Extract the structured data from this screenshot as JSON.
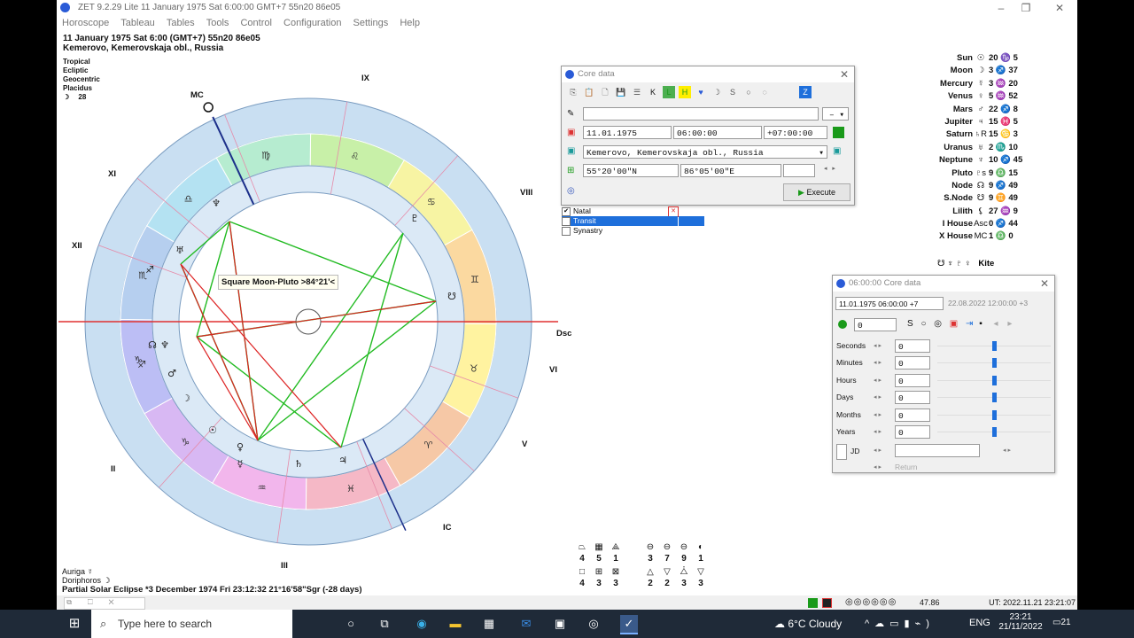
{
  "window": {
    "title": "ZET 9.2.29 Lite   11 January 1975  Sat   6:00:00 GMT+7 55n20  86e05",
    "menu": [
      "Horoscope",
      "Tableau",
      "Tables",
      "Tools",
      "Control",
      "Configuration",
      "Settings",
      "Help"
    ]
  },
  "header": {
    "line1": "11 January 1975  Sat   6:00  (GMT+7)  55n20   86e05",
    "line2": "Kemerovo, Kemerovskaja obl., Russia",
    "meta": [
      "Tropical",
      "Ecliptic",
      "Geocentric",
      "Placidus"
    ],
    "moon_day": "28"
  },
  "chart": {
    "house_labels": [
      "MC",
      "IX",
      "VIII",
      "Dsc",
      "VI",
      "V",
      "IC",
      "III",
      "II",
      "XII",
      "XI"
    ],
    "tooltip": "Square Moon-Pluto >84°21'<",
    "colors": {
      "outer_ring": "#c9dff2",
      "inner_ring": "#dbe9f6",
      "aspect_green": "#22bb22",
      "aspect_red": "#dd2222"
    }
  },
  "planets": [
    {
      "name": "Sun",
      "glyph": "☉",
      "pos": "20 ♑ 5"
    },
    {
      "name": "Moon",
      "glyph": "☽",
      "pos": "3 ♐ 37"
    },
    {
      "name": "Mercury",
      "glyph": "☿",
      "pos": "3 ♒ 20"
    },
    {
      "name": "Venus",
      "glyph": "♀",
      "pos": "5 ♒ 52"
    },
    {
      "name": "Mars",
      "glyph": "♂",
      "pos": "22 ♐ 8"
    },
    {
      "name": "Jupiter",
      "glyph": "♃",
      "pos": "15 ♓ 5"
    },
    {
      "name": "Saturn",
      "glyph": "♄R",
      "pos": "15 ♋ 3"
    },
    {
      "name": "Uranus",
      "glyph": "♅",
      "pos": "2 ♏ 10"
    },
    {
      "name": "Neptune",
      "glyph": "♆",
      "pos": "10 ♐ 45"
    },
    {
      "name": "Pluto",
      "glyph": "♇s",
      "pos": "9 ♎ 15"
    },
    {
      "name": "Node",
      "glyph": "☊",
      "pos": "9 ♐ 49"
    },
    {
      "name": "S.Node",
      "glyph": "☋",
      "pos": "9 ♊ 49"
    },
    {
      "name": "Lilith",
      "glyph": "⚸",
      "pos": "27 ♒ 9"
    },
    {
      "name": "I House",
      "glyph": "Asc",
      "pos": "0 ♐ 44"
    },
    {
      "name": "X House",
      "glyph": "MC",
      "pos": "1 ♎ 0"
    }
  ],
  "kite": {
    "glyphs": "☋ ♆ ♇ ♀",
    "label": "Kite"
  },
  "core_data": {
    "title": "Core data",
    "date": "11.01.1975",
    "time": "06:00:00",
    "zone": "+07:00:00",
    "place": "Kemerovo, Kemerovskaja obl., Russia",
    "lat": "55°20'00\"N",
    "lon": "86°05'00\"E",
    "execute_label": "Execute",
    "toolbar": [
      "⎘",
      "📋",
      "🗋",
      "💾",
      "☰",
      "K",
      "L",
      "H",
      "♥",
      "☽",
      "S",
      "○",
      "◌",
      "Z"
    ],
    "options": [
      {
        "label": "Natal",
        "checked": true
      },
      {
        "label": "Transit",
        "checked": false,
        "selected": true
      },
      {
        "label": "Synastry",
        "checked": false
      }
    ]
  },
  "timer_panel": {
    "title": "06:00:00 Core data",
    "from": "11.01.1975  06:00:00  +7",
    "to": "22.08.2022   12:00:00  +3",
    "step_value": "0",
    "rows": [
      {
        "label": "Seconds",
        "value": "0"
      },
      {
        "label": "Minutes",
        "value": "0"
      },
      {
        "label": "Hours",
        "value": "0"
      },
      {
        "label": "Days",
        "value": "0"
      },
      {
        "label": "Months",
        "value": "0"
      },
      {
        "label": "Years",
        "value": "0"
      }
    ],
    "jd_label": "JD",
    "return_label": "Return"
  },
  "aspect_counts": {
    "row1_glyphs": [
      "⏢",
      "▦",
      "⟁",
      "⊖",
      "⊖",
      "⊖",
      "◐"
    ],
    "row1_vals": [
      "4",
      "5",
      "1",
      "3",
      "7",
      "9",
      "1"
    ],
    "row2_glyphs": [
      "□",
      "⊞",
      "⊠",
      "△",
      "▽",
      "⧊",
      "▽"
    ],
    "row2_vals": [
      "4",
      "3",
      "3",
      "2",
      "2",
      "3",
      "3"
    ]
  },
  "bottom": {
    "star1": "Auriga  ☿",
    "star2": "Doriphoros  ☽",
    "eclipse": "Partial Solar Eclipse *3 December 1974 Fri 23:12:32 21°16'58\"Sgr (-28 days)"
  },
  "status": {
    "value": "47.86",
    "ut": "UT: 2022.11.21 23:21:07"
  },
  "taskbar": {
    "search_placeholder": "Type here to search",
    "weather": "6°C  Cloudy",
    "lang": "ENG",
    "time": "23:21",
    "date": "21/11/2022",
    "notif": "21"
  }
}
